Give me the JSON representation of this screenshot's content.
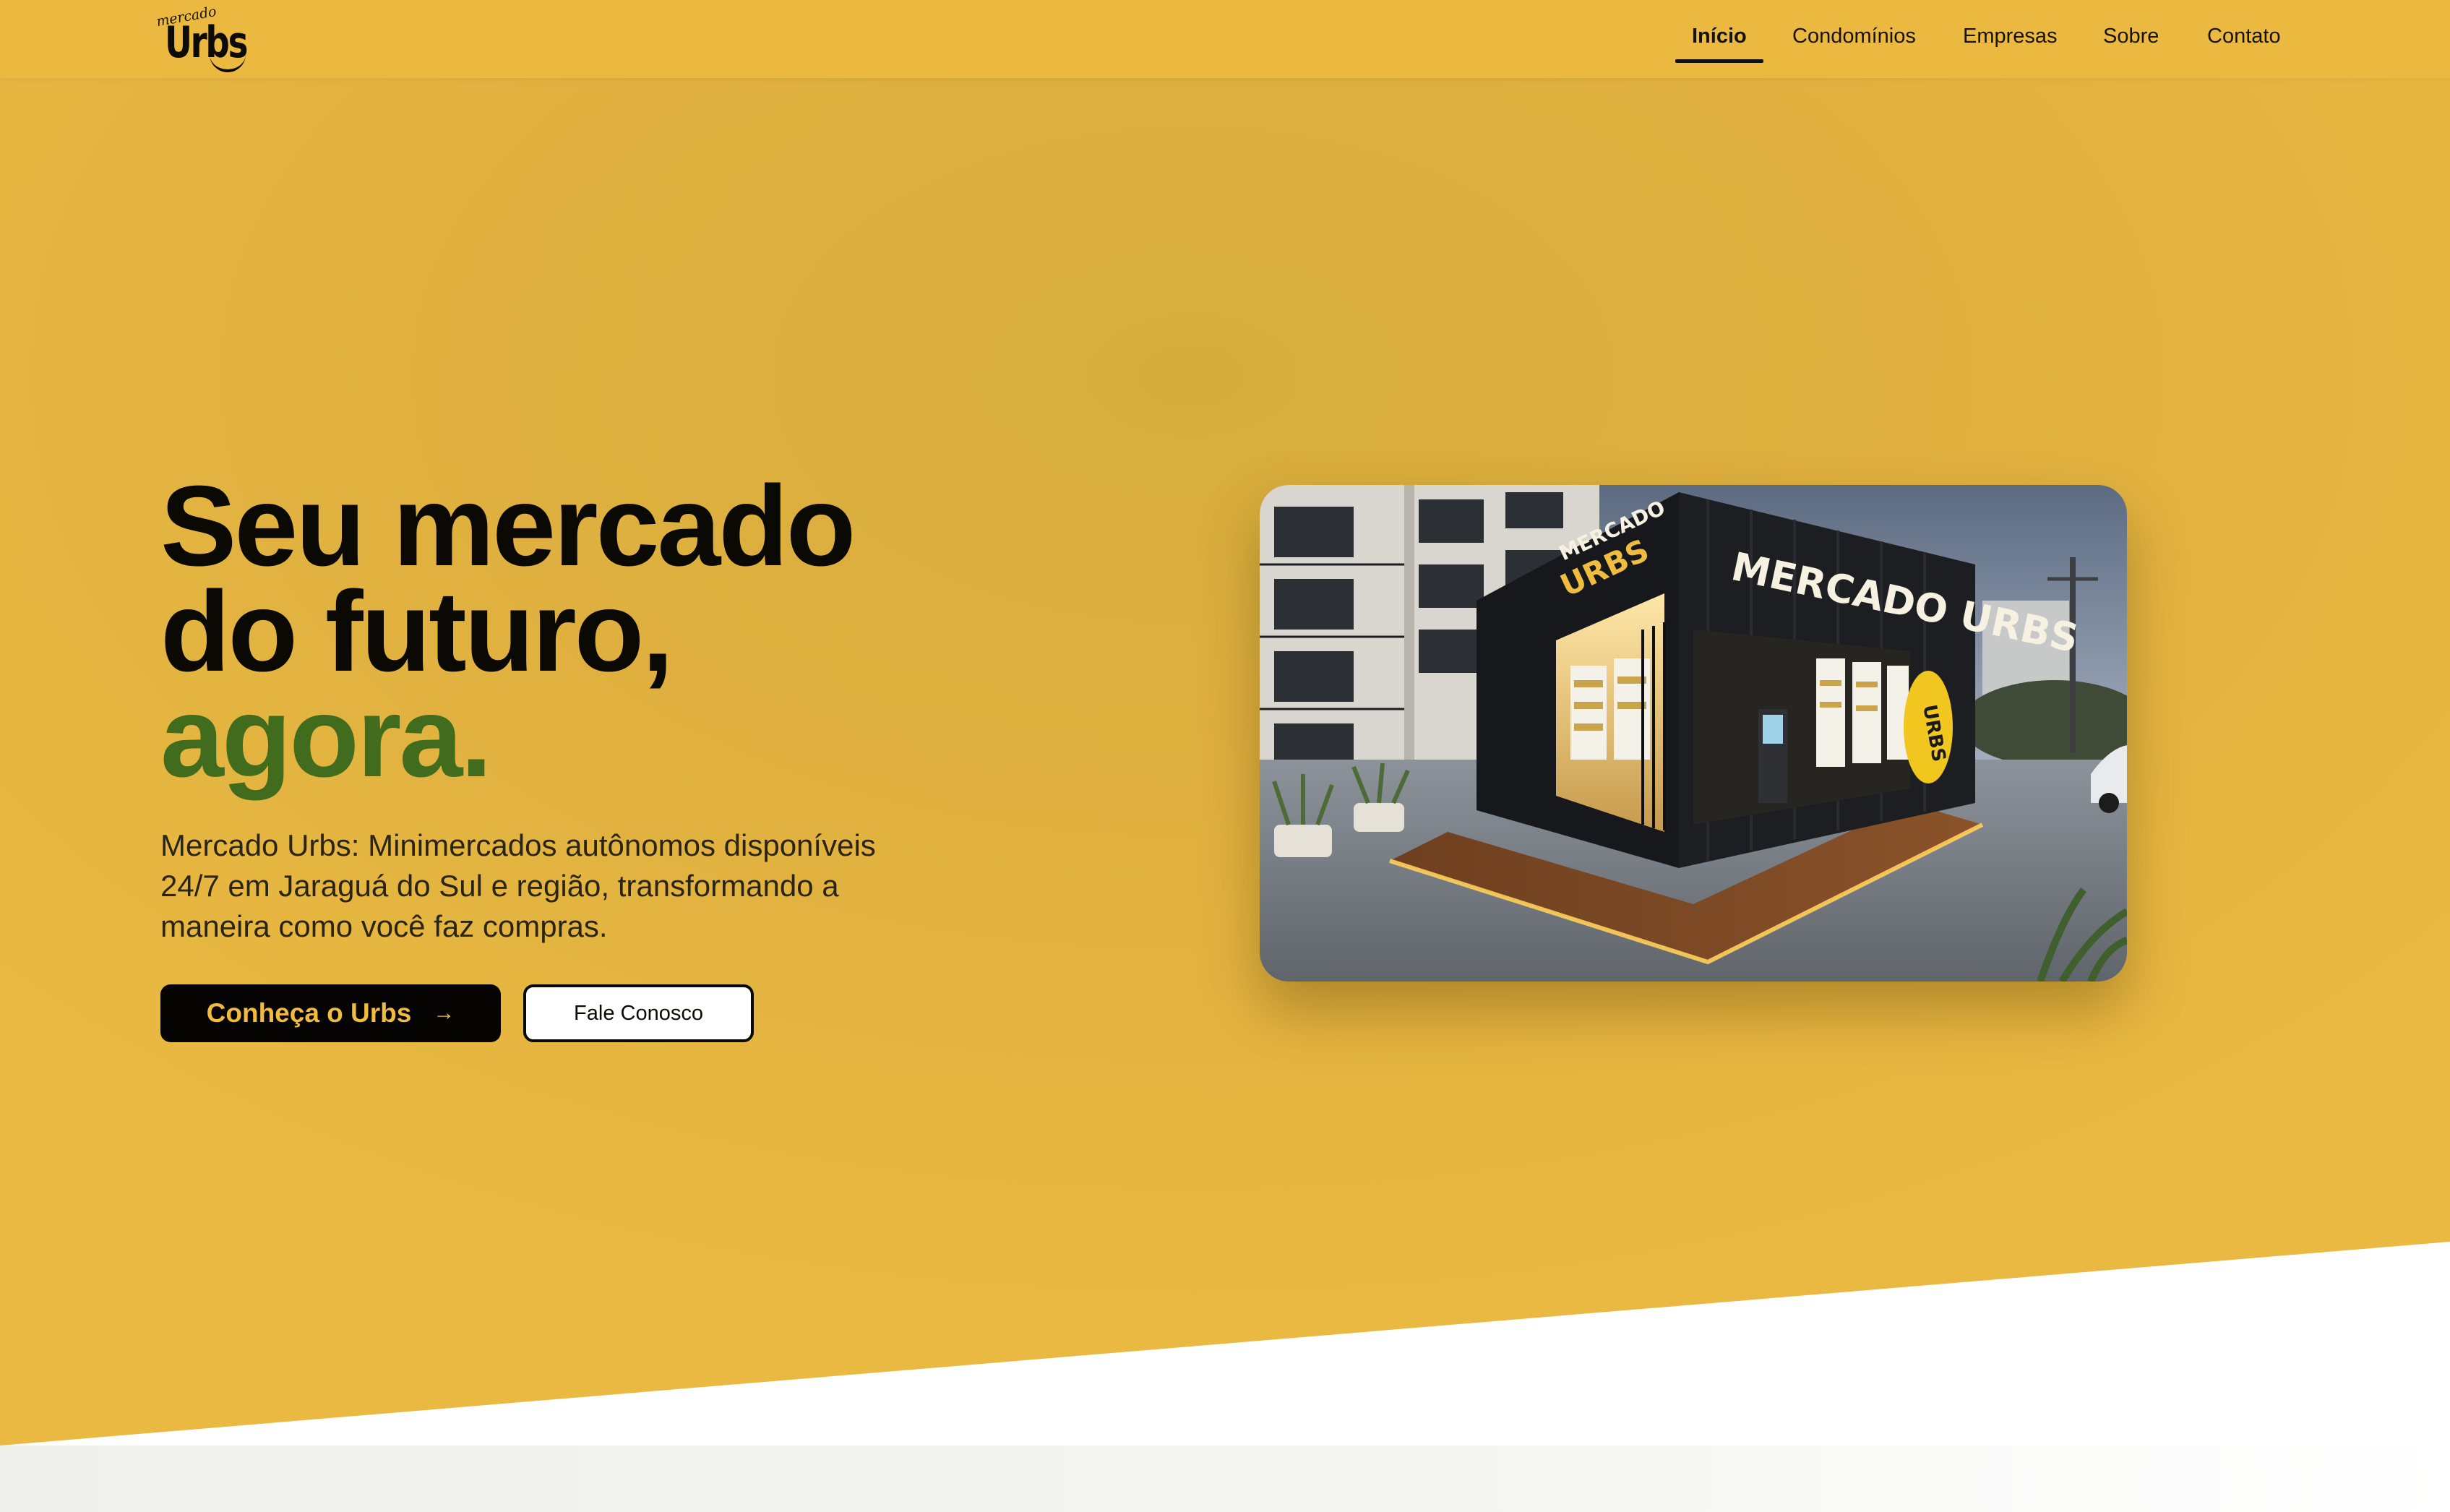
{
  "brand": {
    "logo_small": "mercado",
    "logo_main": "Urbs",
    "accent_color": "#ebb940",
    "headline_accent_color": "#416b1d"
  },
  "nav": {
    "items": [
      {
        "label": "Início",
        "active": true
      },
      {
        "label": "Condomínios",
        "active": false
      },
      {
        "label": "Empresas",
        "active": false
      },
      {
        "label": "Sobre",
        "active": false
      },
      {
        "label": "Contato",
        "active": false
      }
    ]
  },
  "hero": {
    "headline_line1": "Seu mercado",
    "headline_line2": "do futuro,",
    "headline_accent": "agora.",
    "subtitle": "Mercado Urbs: Minimercados autônomos disponíveis 24/7 em Jaraguá do Sul e região, transformando a maneira como você faz compras.",
    "primary_button": "Conheça o Urbs",
    "primary_button_icon": "arrow-right-icon",
    "secondary_button": "Fale Conosco"
  },
  "image": {
    "sign_front": "MERCADO URBS",
    "sign_side_top": "MERCADO",
    "sign_side_bottom": "URBS",
    "circle_logo": "URBS"
  }
}
